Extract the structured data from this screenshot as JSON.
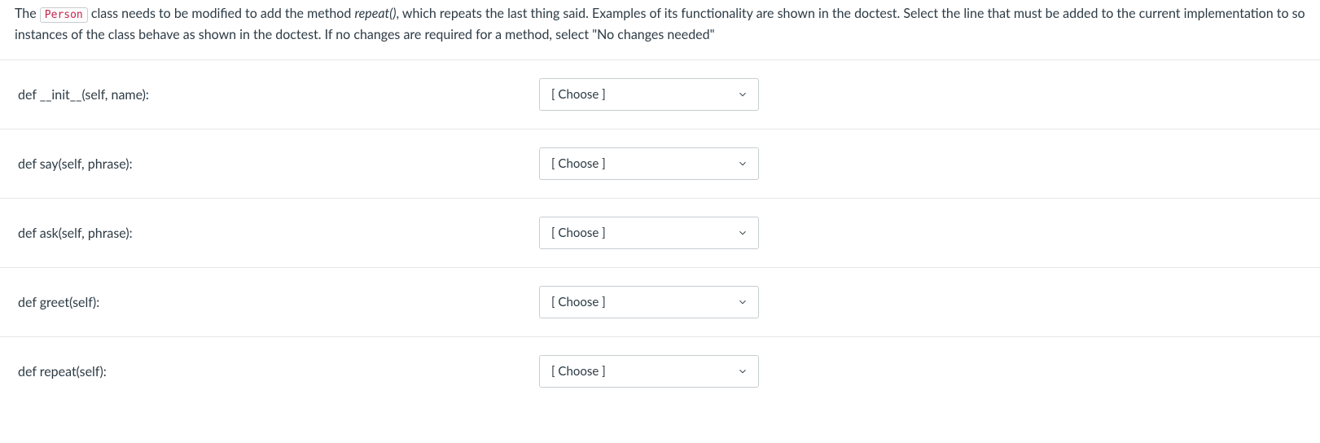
{
  "prompt": {
    "before_code": "The ",
    "code_token": "Person",
    "after_code_before_italic": " class needs to be modified to add the method ",
    "italic_text": "repeat()",
    "after_italic": ",  which repeats the last thing said.  Examples of its functionality are shown in the doctest. Select the line that must be added to the current implementation to so instances of the class behave as shown in the doctest. If no changes are required for a method, select \"No changes needed\""
  },
  "rows": [
    {
      "label": "def __init__(self, name):",
      "dropdown": "[ Choose ]"
    },
    {
      "label": "def say(self, phrase):",
      "dropdown": "[ Choose ]"
    },
    {
      "label": "def ask(self, phrase):",
      "dropdown": "[ Choose ]"
    },
    {
      "label": "def greet(self):",
      "dropdown": "[ Choose ]"
    },
    {
      "label": "def repeat(self):",
      "dropdown": "[ Choose ]"
    }
  ]
}
